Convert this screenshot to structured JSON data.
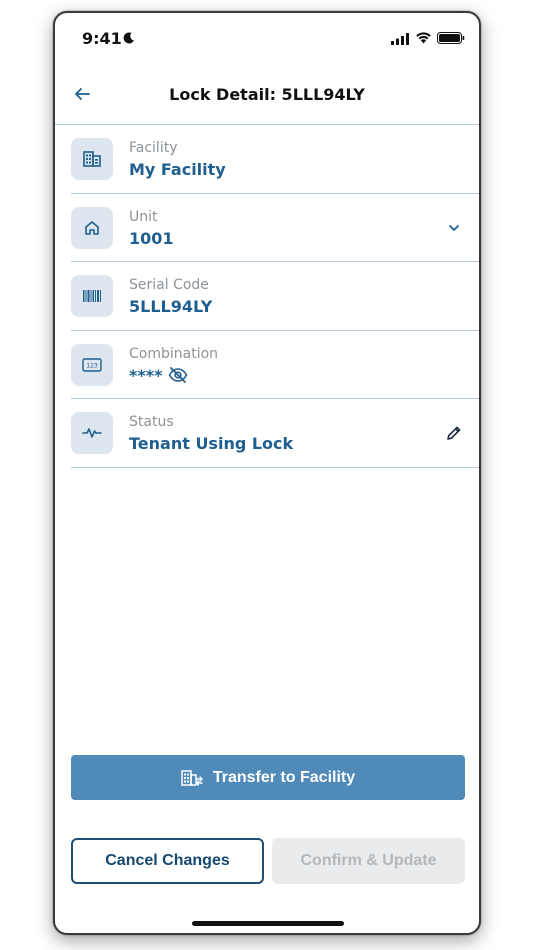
{
  "status_bar": {
    "time": "9:41"
  },
  "header": {
    "title": "Lock Detail: 5LLL94LY"
  },
  "rows": [
    {
      "icon": "building-icon",
      "label": "Facility",
      "value": "My Facility"
    },
    {
      "icon": "home-icon",
      "label": "Unit",
      "value": "1001",
      "action_icon": "chevron-down-icon"
    },
    {
      "icon": "barcode-icon",
      "label": "Serial Code",
      "value": "5LLL94LY"
    },
    {
      "icon": "keypad-icon",
      "label": "Combination",
      "value": "****",
      "extra_icon": "eye-off-icon"
    },
    {
      "icon": "activity-icon",
      "label": "Status",
      "value": "Tenant Using Lock",
      "action_icon": "pencil-icon"
    }
  ],
  "actions": {
    "transfer_label": "Transfer to Facility",
    "cancel_label": "Cancel Changes",
    "confirm_label": "Confirm & Update"
  },
  "colors": {
    "accent": "#1f5f8f",
    "primary_button": "#4f8ab8",
    "icon_box": "#dde6ee",
    "disabled_bg": "#e9ebed",
    "disabled_text": "#b3b8bc",
    "divider": "#b8c9d6"
  }
}
